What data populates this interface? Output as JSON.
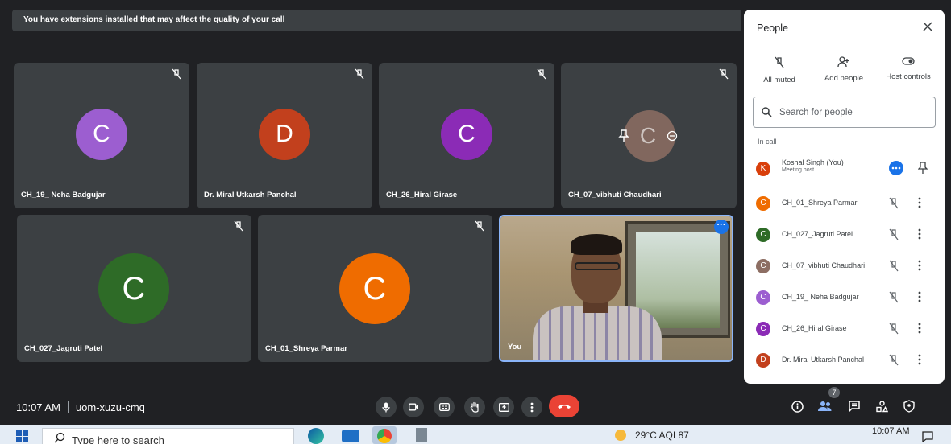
{
  "banner": {
    "text": "You have extensions installed that may affect the quality of your call"
  },
  "tiles": [
    {
      "name": "CH_19_ Neha Badgujar",
      "initial": "C",
      "color": "#9c5ed0"
    },
    {
      "name": "Dr. Miral Utkarsh Panchal",
      "initial": "D",
      "color": "#c2401d"
    },
    {
      "name": "CH_26_Hiral Girase",
      "initial": "C",
      "color": "#8b2bb6"
    },
    {
      "name": "CH_07_vibhuti Chaudhari",
      "initial": "C",
      "color": "#8d6e63"
    },
    {
      "name": "CH_027_Jagruti Patel",
      "initial": "C",
      "color": "#2e6b27"
    },
    {
      "name": "CH_01_Shreya Parmar",
      "initial": "C",
      "color": "#ef6c00"
    },
    {
      "name": "You"
    }
  ],
  "bottom": {
    "time": "10:07 AM",
    "meeting_code": "uom-xuzu-cmq",
    "participant_count": "7"
  },
  "panel": {
    "title": "People",
    "actions": [
      "All muted",
      "Add people",
      "Host controls"
    ],
    "search_placeholder": "Search for people",
    "section": "In call",
    "people": [
      {
        "name": "Koshal Singh (You)",
        "sub": "Meeting host",
        "initial": "K",
        "color": "#d93f0b"
      },
      {
        "name": "CH_01_Shreya Parmar",
        "initial": "C",
        "color": "#ef6c00"
      },
      {
        "name": "CH_027_Jagruti Patel",
        "initial": "C",
        "color": "#2e6b27"
      },
      {
        "name": "CH_07_vibhuti Chaudhari",
        "initial": "C",
        "color": "#8d6e63"
      },
      {
        "name": "CH_19_ Neha Badgujar",
        "initial": "C",
        "color": "#9c5ed0"
      },
      {
        "name": "CH_26_Hiral Girase",
        "initial": "C",
        "color": "#8b2bb6"
      },
      {
        "name": "Dr. Miral Utkarsh Panchal",
        "initial": "D",
        "color": "#c2401d"
      }
    ]
  },
  "taskbar": {
    "search_placeholder": "Type here to search",
    "weather": "29°C  AQI 87",
    "clock": "10:07 AM"
  },
  "colors": {
    "accent": "#1a73e8",
    "hangup": "#ea4335",
    "background": "#202124",
    "tile": "#3c4043"
  }
}
